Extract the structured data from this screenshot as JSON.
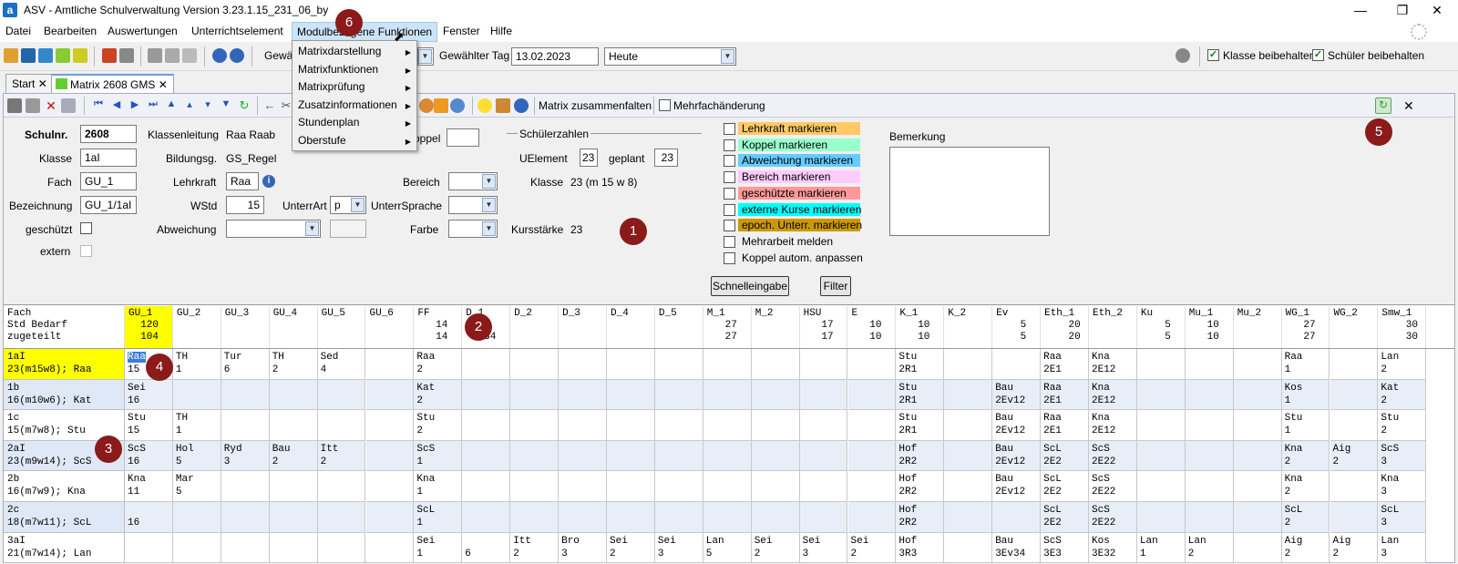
{
  "window": {
    "title": "ASV - Amtliche Schulverwaltung Version 3.23.1.15_231_06_by",
    "app_icon": "a"
  },
  "menu": [
    "Datei",
    "Bearbeiten",
    "Auswertungen",
    "Unterrichtselement",
    "Modulbezogene Funktionen",
    "Fenster",
    "Hilfe"
  ],
  "dropdown": [
    "Matrixdarstellung",
    "Matrixfunktionen",
    "Matrixprüfung",
    "Zusatzinformationen",
    "Stundenplan",
    "Oberstufe"
  ],
  "toolbar1": {
    "gewaehlt_label": "Gewä",
    "tag_label": "Gewählter Tag",
    "tag_value": "13.02.2023",
    "heute_value": "Heute",
    "klasse_beibehalten": "Klasse beibehalten",
    "schueler_beibehalten": "Schüler beibehalten"
  },
  "tabs": [
    "Start",
    "Matrix 2608 GMS"
  ],
  "toolbar2": {
    "zusammenfalten": "Matrix zusammenfalten",
    "mehrfach": "Mehrfachänderung"
  },
  "form": {
    "schulnr_label": "Schulnr.",
    "schulnr": "2608",
    "klasse_label": "Klasse",
    "klasse": "1aI",
    "fach_label": "Fach",
    "fach": "GU_1",
    "bezeichnung_label": "Bezeichnung",
    "bezeichnung": "GU_1/1aI",
    "geschuetzt_label": "geschützt",
    "extern_label": "extern",
    "klassenleitung_label": "Klassenleitung",
    "klassenleitung": "Raa Raab",
    "bildungsg_label": "Bildungsg.",
    "bildungsg": "GS_Regel",
    "lehrkraft_label": "Lehrkraft",
    "lehrkraft": "Raa",
    "wstd_label": "WStd",
    "wstd": "15",
    "unterrart_label": "UnterrArt",
    "unterrart": "p",
    "abweichung_label": "Abweichung",
    "koppel_label": "oppel",
    "bereich_label": "Bereich",
    "untersprache_label": "UnterrSprache",
    "farbe_label": "Farbe",
    "schuelerzahlen_label": "Schülerzahlen",
    "uelement_label": "UElement",
    "uelement": "23",
    "geplant_label": "geplant",
    "geplant": "23",
    "klasse2_label": "Klasse",
    "klasse2": "23 (m 15 w 8)",
    "kursstaerke_label": "Kursstärke",
    "kursstaerke": "23",
    "bemerkung_label": "Bemerkung",
    "schnelleingabe": "Schnelleingabe",
    "filter": "Filter"
  },
  "markers": [
    {
      "label": "Lehrkraft markieren",
      "color": "#ffc966"
    },
    {
      "label": "Koppel markieren",
      "color": "#99ffcc"
    },
    {
      "label": "Abweichung markieren",
      "color": "#66ccff"
    },
    {
      "label": "Bereich markieren",
      "color": "#ffccff"
    },
    {
      "label": "geschützte markieren",
      "color": "#ff9999"
    },
    {
      "label": "externe Kurse markieren",
      "color": "#00ffff"
    },
    {
      "label": "epoch. Unterr. markieren",
      "color": "#cc9900"
    },
    {
      "label": "Mehrarbeit melden",
      "color": ""
    },
    {
      "label": "Koppel autom. anpassen",
      "color": ""
    }
  ],
  "badges": [
    "1",
    "2",
    "3",
    "4",
    "5",
    "6"
  ],
  "grid": {
    "corner": "Fach\nStd Bedarf\nzugeteilt",
    "columns": [
      {
        "name": "GU_1",
        "bedarf": "120",
        "zugeteilt": "104"
      },
      {
        "name": "GU_2",
        "bedarf": "",
        "zugeteilt": ""
      },
      {
        "name": "GU_3",
        "bedarf": "",
        "zugeteilt": ""
      },
      {
        "name": "GU_4",
        "bedarf": "",
        "zugeteilt": ""
      },
      {
        "name": "GU_5",
        "bedarf": "",
        "zugeteilt": ""
      },
      {
        "name": "GU_6",
        "bedarf": "",
        "zugeteilt": ""
      },
      {
        "name": "FF",
        "bedarf": "14",
        "zugeteilt": "14"
      },
      {
        "name": "D_1",
        "bedarf": "",
        "zugeteilt": "34"
      },
      {
        "name": "D_2",
        "bedarf": "",
        "zugeteilt": ""
      },
      {
        "name": "D_3",
        "bedarf": "",
        "zugeteilt": ""
      },
      {
        "name": "D_4",
        "bedarf": "",
        "zugeteilt": ""
      },
      {
        "name": "D_5",
        "bedarf": "",
        "zugeteilt": ""
      },
      {
        "name": "M_1",
        "bedarf": "27",
        "zugeteilt": "27"
      },
      {
        "name": "M_2",
        "bedarf": "",
        "zugeteilt": ""
      },
      {
        "name": "HSU",
        "bedarf": "17",
        "zugeteilt": "17"
      },
      {
        "name": "E",
        "bedarf": "10",
        "zugeteilt": "10"
      },
      {
        "name": "K_1",
        "bedarf": "10",
        "zugeteilt": "10"
      },
      {
        "name": "K_2",
        "bedarf": "",
        "zugeteilt": ""
      },
      {
        "name": "Ev",
        "bedarf": "5",
        "zugeteilt": "5"
      },
      {
        "name": "Eth_1",
        "bedarf": "20",
        "zugeteilt": "20"
      },
      {
        "name": "Eth_2",
        "bedarf": "",
        "zugeteilt": ""
      },
      {
        "name": "Ku",
        "bedarf": "5",
        "zugeteilt": "5"
      },
      {
        "name": "Mu_1",
        "bedarf": "10",
        "zugeteilt": "10"
      },
      {
        "name": "Mu_2",
        "bedarf": "",
        "zugeteilt": ""
      },
      {
        "name": "WG_1",
        "bedarf": "27",
        "zugeteilt": "27"
      },
      {
        "name": "WG_2",
        "bedarf": "",
        "zugeteilt": ""
      },
      {
        "name": "Smw_1",
        "bedarf": "30",
        "zugeteilt": "30"
      }
    ],
    "rows": [
      {
        "head": "1aI\n23(m15w8); Raa",
        "hl": true,
        "cells": [
          "Raa\n15",
          "TH\n1",
          "Tur\n6",
          "TH\n2",
          "Sed\n4",
          "",
          "Raa\n2",
          "",
          "",
          "",
          "",
          "",
          "",
          "",
          "",
          "",
          "Stu\n2R1",
          "",
          "",
          "Raa\n2E1",
          "Kna\n2E12",
          "",
          "",
          "",
          "Raa\n1",
          "",
          "Lan\n2"
        ]
      },
      {
        "head": "1b\n16(m10w6); Kat",
        "alt": true,
        "cells": [
          "Sei\n16",
          "",
          "",
          "",
          "",
          "",
          "Kat\n2",
          "",
          "",
          "",
          "",
          "",
          "",
          "",
          "",
          "",
          "Stu\n2R1",
          "",
          "Bau\n2Ev12",
          "Raa\n2E1",
          "Kna\n2E12",
          "",
          "",
          "",
          "Kos\n1",
          "",
          "Kat\n2"
        ]
      },
      {
        "head": "1c\n15(m7w8); Stu",
        "cells": [
          "Stu\n15",
          "TH\n1",
          "",
          "",
          "",
          "",
          "Stu\n2",
          "",
          "",
          "",
          "",
          "",
          "",
          "",
          "",
          "",
          "Stu\n2R1",
          "",
          "Bau\n2Ev12",
          "Raa\n2E1",
          "Kna\n2E12",
          "",
          "",
          "",
          "Stu\n1",
          "",
          "Stu\n2"
        ]
      },
      {
        "head": "2aI\n23(m9w14); ScS",
        "alt": true,
        "cells": [
          "ScS\n16",
          "Hol\n5",
          "Ryd\n3",
          "Bau\n2",
          "Itt\n2",
          "",
          "ScS\n1",
          "",
          "",
          "",
          "",
          "",
          "",
          "",
          "",
          "",
          "Hof\n2R2",
          "",
          "Bau\n2Ev12",
          "ScL\n2E2",
          "ScS\n2E22",
          "",
          "",
          "",
          "Kna\n2",
          "Aig\n2",
          "ScS\n3"
        ]
      },
      {
        "head": "2b\n16(m7w9); Kna",
        "cells": [
          "Kna\n11",
          "Mar\n5",
          "",
          "",
          "",
          "",
          "Kna\n1",
          "",
          "",
          "",
          "",
          "",
          "",
          "",
          "",
          "",
          "Hof\n2R2",
          "",
          "Bau\n2Ev12",
          "ScL\n2E2",
          "ScS\n2E22",
          "",
          "",
          "",
          "Kna\n2",
          "",
          "Kna\n3"
        ]
      },
      {
        "head": "2c\n18(m7w11); ScL",
        "alt": true,
        "cells": [
          "\n16",
          "",
          "",
          "",
          "",
          "",
          "ScL\n1",
          "",
          "",
          "",
          "",
          "",
          "",
          "",
          "",
          "",
          "Hof\n2R2",
          "",
          "",
          "ScL\n2E2",
          "ScS\n2E22",
          "",
          "",
          "",
          "ScL\n2",
          "",
          "ScL\n3"
        ]
      },
      {
        "head": "3aI\n21(m7w14); Lan",
        "cells": [
          "",
          "",
          "",
          "",
          "",
          "",
          "Sei\n1",
          "\n6",
          "Itt\n2",
          "Bro\n3",
          "Sei\n2",
          "Sei\n3",
          "Lan\n5",
          "Sei\n2",
          "Sei\n3",
          "Sei\n2",
          "Hof\n3R3",
          "",
          "Bau\n3Ev34",
          "ScS\n3E3",
          "Kos\n3E32",
          "Lan\n1",
          "Lan\n2",
          "",
          "Aig\n2",
          "Aig\n2",
          "Lan\n3"
        ]
      }
    ]
  }
}
